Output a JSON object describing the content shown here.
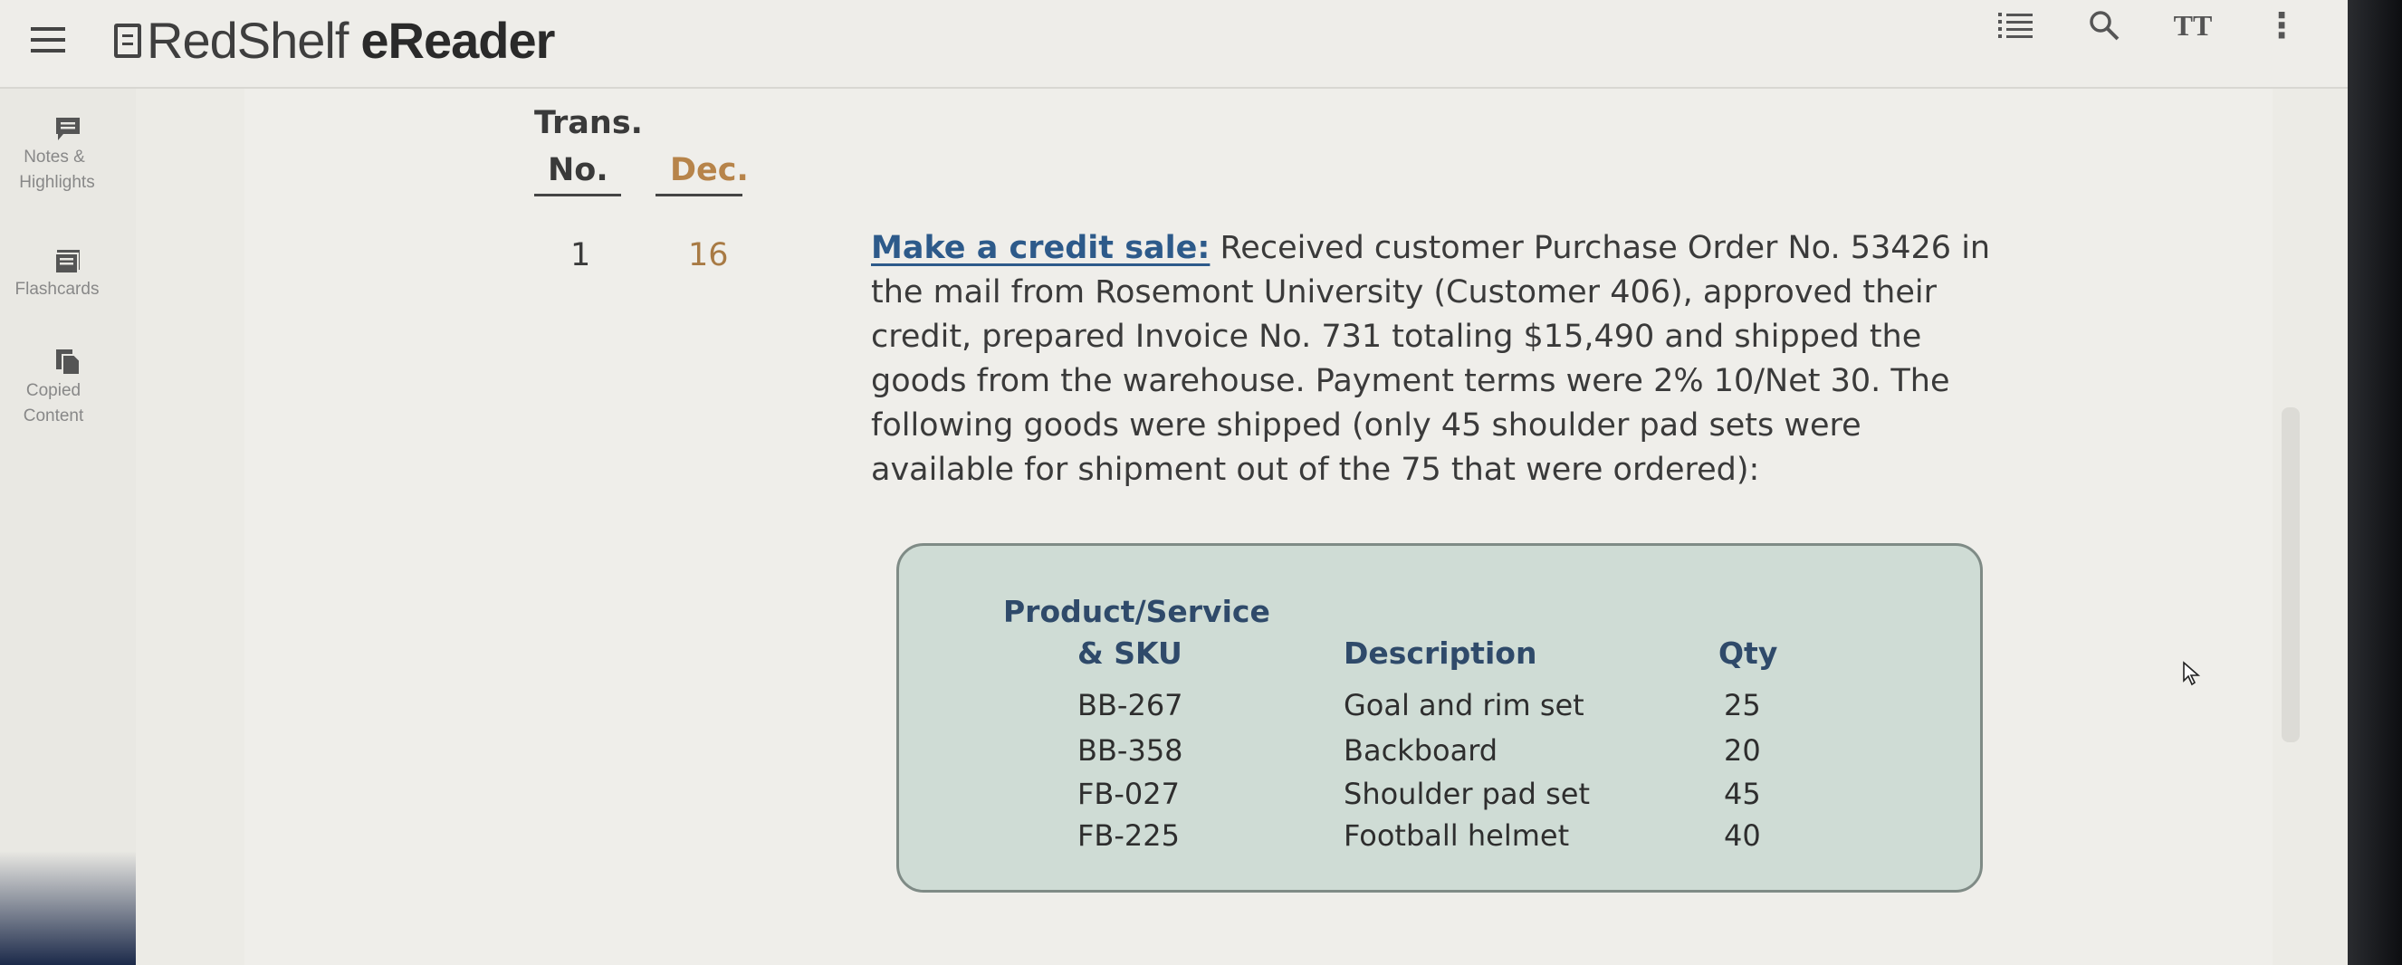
{
  "app": {
    "brand_name": "RedShelf",
    "brand_suffix": "eReader"
  },
  "toolbar": {
    "icons": [
      "menu-icon",
      "toc-icon",
      "search-icon",
      "text-size-icon",
      "more-vert-icon"
    ],
    "text_size_label": "TT",
    "more_label": "⋮"
  },
  "sidebar": {
    "items": [
      {
        "label_line1": "Notes &",
        "label_line2": "Highlights",
        "icon": "notes-icon"
      },
      {
        "label_line1": "Flashcards",
        "label_line2": "",
        "icon": "flashcards-icon"
      },
      {
        "label_line1": "Copied",
        "label_line2": "Content",
        "icon": "copied-content-icon"
      }
    ]
  },
  "content": {
    "header_trans_line1": "Trans.",
    "header_trans_line2": "No.",
    "header_date": "Dec.",
    "trans_no": "1",
    "trans_date": "16",
    "lead": "Make a credit sale:",
    "paragraph": "Received customer Purchase Order No. 53426 in the mail from Rosemont University (Customer 406), approved their credit, prepared Invoice No. 731 totaling $15,490 and shipped the goods from the warehouse. Payment terms were 2% 10/Net 30. The following goods were shipped (only 45 shoulder pad sets were available for shipment out of the 75 that were ordered):",
    "table": {
      "header_product_line1": "Product/Service",
      "header_product_line2": "& SKU",
      "header_description": "Description",
      "header_qty": "Qty",
      "rows": [
        {
          "sku": "BB-267",
          "description": "Goal and rim set",
          "qty": "25"
        },
        {
          "sku": "BB-358",
          "description": "Backboard",
          "qty": "20"
        },
        {
          "sku": "FB-027",
          "description": "Shoulder pad set",
          "qty": "45"
        },
        {
          "sku": "FB-225",
          "description": "Football helmet",
          "qty": "40"
        }
      ]
    }
  },
  "colors": {
    "lead_link": "#2d5a8a",
    "date_accent": "#b7844a",
    "card_bg": "#cfdcd5",
    "table_header": "#2f4a6a"
  }
}
